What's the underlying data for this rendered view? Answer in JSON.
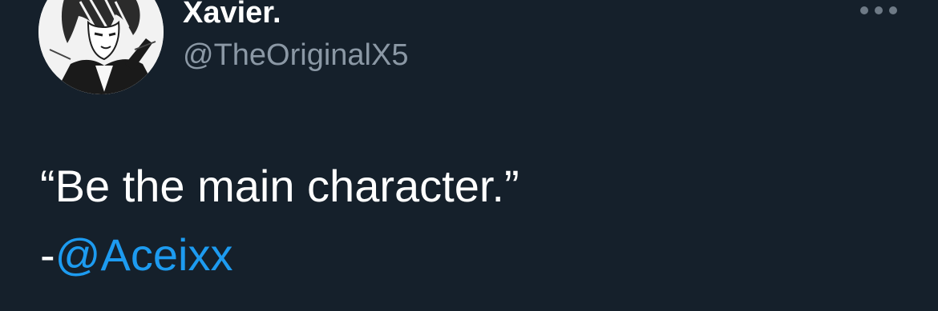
{
  "author": {
    "display_name": "Xavier.",
    "handle": "@TheOriginalX5",
    "avatar_icon": "manga-portrait-avatar"
  },
  "menu": {
    "more_icon": "more-horizontal-icon"
  },
  "tweet": {
    "quote": "“Be the main character.”",
    "attribution_prefix": "-",
    "attribution_mention": "@Aceixx"
  },
  "colors": {
    "background": "#15202b",
    "text_primary": "#ffffff",
    "text_secondary": "#8b98a5",
    "link": "#1d9bf0"
  }
}
